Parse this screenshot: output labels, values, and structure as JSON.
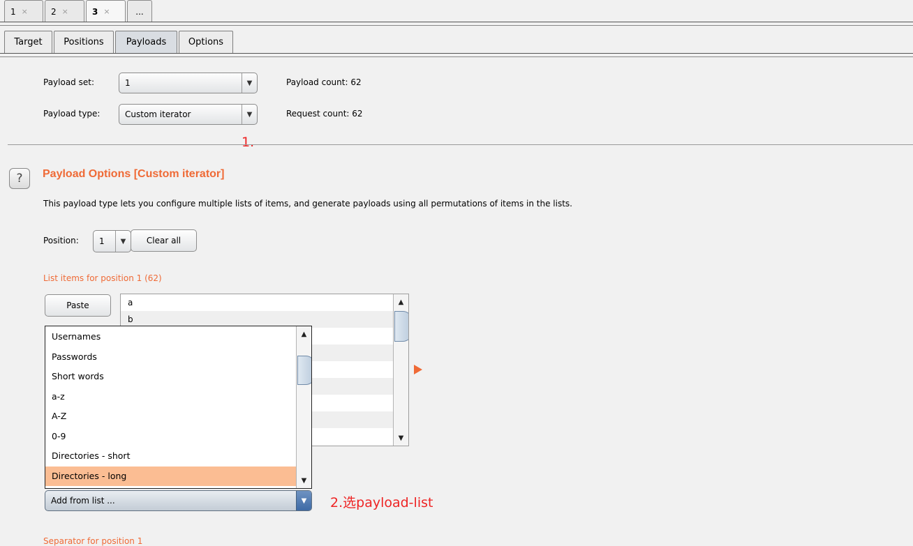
{
  "intruder_tabs": [
    {
      "label": "1",
      "close": "×"
    },
    {
      "label": "2",
      "close": "×"
    },
    {
      "label": "3",
      "close": "×"
    },
    {
      "label": "..."
    }
  ],
  "sub_tabs": [
    "Target",
    "Positions",
    "Payloads",
    "Options"
  ],
  "payload_set": {
    "label": "Payload set:",
    "value": "1"
  },
  "payload_type": {
    "label": "Payload type:",
    "value": "Custom iterator"
  },
  "payload_count": {
    "label": "Payload count:",
    "value": "62"
  },
  "request_count": {
    "label": "Request count:",
    "value": "62"
  },
  "annotation_1": "1.",
  "annotation_2": "2.选payload-list",
  "help_icon": "?",
  "section_title": "Payload Options [Custom iterator]",
  "section_desc": "This payload type lets you configure multiple lists of items, and generate payloads using all permutations of items in the lists.",
  "position": {
    "label": "Position:",
    "value": "1"
  },
  "clear_all_label": "Clear all",
  "list_header": "List items for position 1 (62)",
  "paste_label": "Paste",
  "list_items": [
    "a",
    "b"
  ],
  "dropdown_options": [
    "Usernames",
    "Passwords",
    "Short words",
    "a-z",
    "A-Z",
    "0-9",
    "Directories - short",
    "Directories - long"
  ],
  "dropdown_selected_index": 7,
  "add_from_list": "Add from list ...",
  "separator_header": "Separator for position 1",
  "colors": {
    "accent": "#ef6a36",
    "annotation": "#ee2424",
    "selected": "#fbbd93"
  }
}
